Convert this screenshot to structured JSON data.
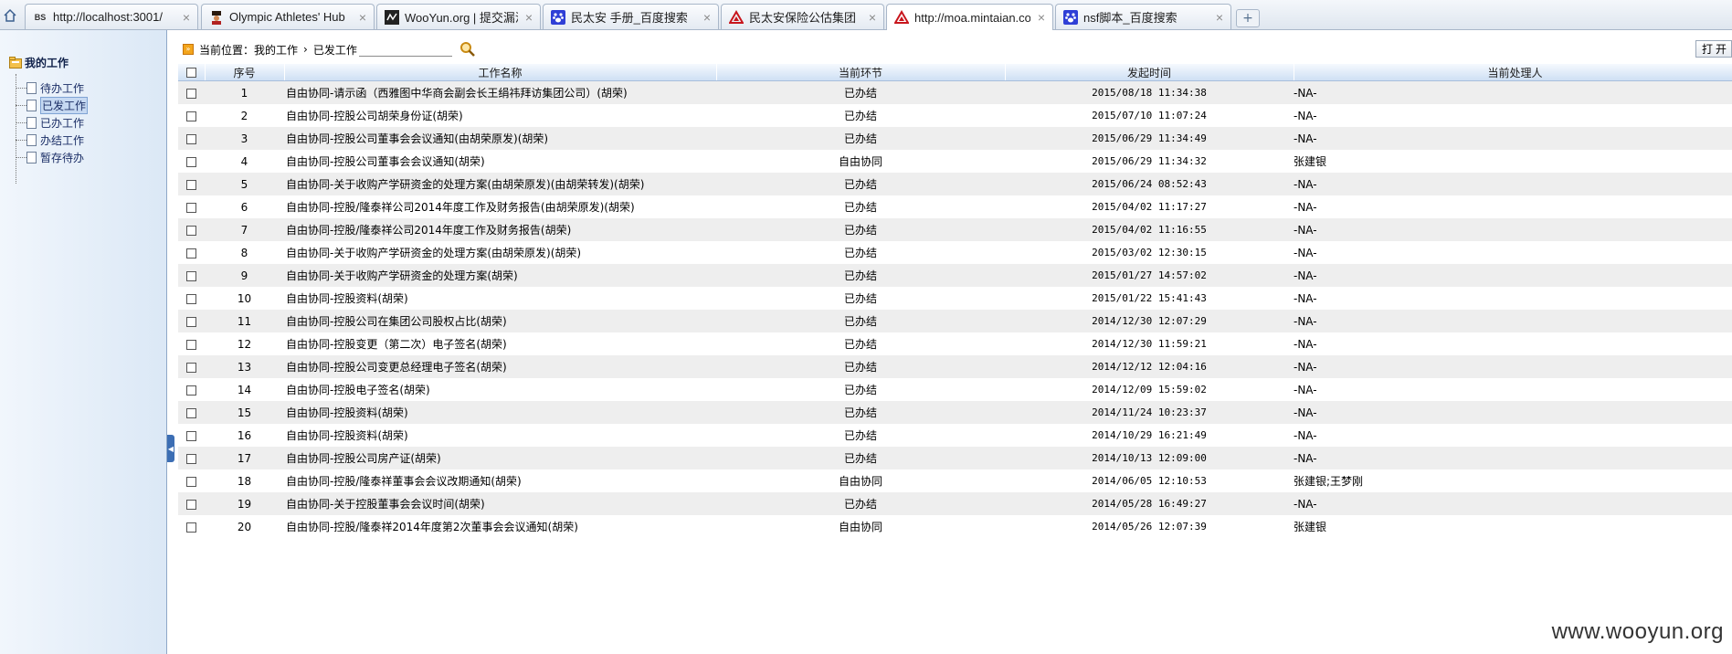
{
  "tabs": [
    {
      "favicon": "bs-text-icon",
      "favicon_text": "BS",
      "title": "http://localhost:3001/"
    },
    {
      "favicon": "olympic-figure-icon",
      "favicon_text": "",
      "title": "Olympic Athletes' Hub"
    },
    {
      "favicon": "wooyun-logo-icon",
      "favicon_text": "",
      "title": "WooYun.org | 提交漏洞"
    },
    {
      "favicon": "baidu-paw-icon",
      "favicon_text": "",
      "title": "民太安 手册_百度搜索"
    },
    {
      "favicon": "mintaian-logo-icon",
      "favicon_text": "",
      "title": "民太安保险公估集团"
    },
    {
      "favicon": "mintaian-logo-icon",
      "favicon_text": "",
      "title": "http://moa.mintaian.co",
      "active": true
    },
    {
      "favicon": "baidu-paw-icon",
      "favicon_text": "",
      "title": "nsf脚本_百度搜索"
    }
  ],
  "tab_close_glyph": "×",
  "new_tab_glyph": "+",
  "sidebar": {
    "root_label": "我的工作",
    "items": [
      {
        "label": "待办工作"
      },
      {
        "label": "已发工作",
        "selected": true
      },
      {
        "label": "已办工作"
      },
      {
        "label": "办结工作"
      },
      {
        "label": "暂存待办"
      }
    ]
  },
  "location": {
    "prefix": "当前位置：",
    "crumb1": "我的工作",
    "sep": "›",
    "crumb2": "已发工作",
    "search_value": ""
  },
  "toolbar": {
    "open_label": "打开"
  },
  "table": {
    "headers": {
      "index": "序号",
      "name": "工作名称",
      "stage": "当前环节",
      "time": "发起时间",
      "handler": "当前处理人"
    },
    "rows": [
      {
        "index": "1",
        "name": "自由协同-请示函（西雅图中华商会副会长王绢祎拜访集团公司）(胡荣)",
        "stage": "已办结",
        "time": "2015/08/18 11:34:38",
        "handler": "-NA-"
      },
      {
        "index": "2",
        "name": "自由协同-控股公司胡荣身份证(胡荣)",
        "stage": "已办结",
        "time": "2015/07/10 11:07:24",
        "handler": "-NA-"
      },
      {
        "index": "3",
        "name": "自由协同-控股公司董事会会议通知(由胡荣原发)(胡荣)",
        "stage": "已办结",
        "time": "2015/06/29 11:34:49",
        "handler": "-NA-"
      },
      {
        "index": "4",
        "name": "自由协同-控股公司董事会会议通知(胡荣)",
        "stage": "自由协同",
        "time": "2015/06/29 11:34:32",
        "handler": "张建银"
      },
      {
        "index": "5",
        "name": "自由协同-关于收购产学研资金的处理方案(由胡荣原发)(由胡荣转发)(胡荣)",
        "stage": "已办结",
        "time": "2015/06/24 08:52:43",
        "handler": "-NA-"
      },
      {
        "index": "6",
        "name": "自由协同-控股/隆泰祥公司2014年度工作及财务报告(由胡荣原发)(胡荣)",
        "stage": "已办结",
        "time": "2015/04/02 11:17:27",
        "handler": "-NA-"
      },
      {
        "index": "7",
        "name": "自由协同-控股/隆泰祥公司2014年度工作及财务报告(胡荣)",
        "stage": "已办结",
        "time": "2015/04/02 11:16:55",
        "handler": "-NA-"
      },
      {
        "index": "8",
        "name": "自由协同-关于收购产学研资金的处理方案(由胡荣原发)(胡荣)",
        "stage": "已办结",
        "time": "2015/03/02 12:30:15",
        "handler": "-NA-"
      },
      {
        "index": "9",
        "name": "自由协同-关于收购产学研资金的处理方案(胡荣)",
        "stage": "已办结",
        "time": "2015/01/27 14:57:02",
        "handler": "-NA-"
      },
      {
        "index": "10",
        "name": "自由协同-控股资料(胡荣)",
        "stage": "已办结",
        "time": "2015/01/22 15:41:43",
        "handler": "-NA-"
      },
      {
        "index": "11",
        "name": "自由协同-控股公司在集团公司股权占比(胡荣)",
        "stage": "已办结",
        "time": "2014/12/30 12:07:29",
        "handler": "-NA-"
      },
      {
        "index": "12",
        "name": "自由协同-控股变更（第二次）电子签名(胡荣)",
        "stage": "已办结",
        "time": "2014/12/30 11:59:21",
        "handler": "-NA-"
      },
      {
        "index": "13",
        "name": "自由协同-控股公司变更总经理电子签名(胡荣)",
        "stage": "已办结",
        "time": "2014/12/12 12:04:16",
        "handler": "-NA-"
      },
      {
        "index": "14",
        "name": "自由协同-控股电子签名(胡荣)",
        "stage": "已办结",
        "time": "2014/12/09 15:59:02",
        "handler": "-NA-"
      },
      {
        "index": "15",
        "name": "自由协同-控股资料(胡荣)",
        "stage": "已办结",
        "time": "2014/11/24 10:23:37",
        "handler": "-NA-"
      },
      {
        "index": "16",
        "name": "自由协同-控股资料(胡荣)",
        "stage": "已办结",
        "time": "2014/10/29 16:21:49",
        "handler": "-NA-"
      },
      {
        "index": "17",
        "name": "自由协同-控股公司房产证(胡荣)",
        "stage": "已办结",
        "time": "2014/10/13 12:09:00",
        "handler": "-NA-"
      },
      {
        "index": "18",
        "name": "自由协同-控股/隆泰祥董事会会议改期通知(胡荣)",
        "stage": "自由协同",
        "time": "2014/06/05 12:10:53",
        "handler": "张建银;王梦刚"
      },
      {
        "index": "19",
        "name": "自由协同-关于控股董事会会议时间(胡荣)",
        "stage": "已办结",
        "time": "2014/05/28 16:49:27",
        "handler": "-NA-"
      },
      {
        "index": "20",
        "name": "自由协同-控股/隆泰祥2014年度第2次董事会会议通知(胡荣)",
        "stage": "自由协同",
        "time": "2014/05/26 12:07:39",
        "handler": "张建银"
      }
    ]
  },
  "watermark": "www.wooyun.org",
  "colors": {
    "accent": "#3c6eb4",
    "row_alt": "#eeeeee",
    "header_bg": "#cfe0f4"
  }
}
